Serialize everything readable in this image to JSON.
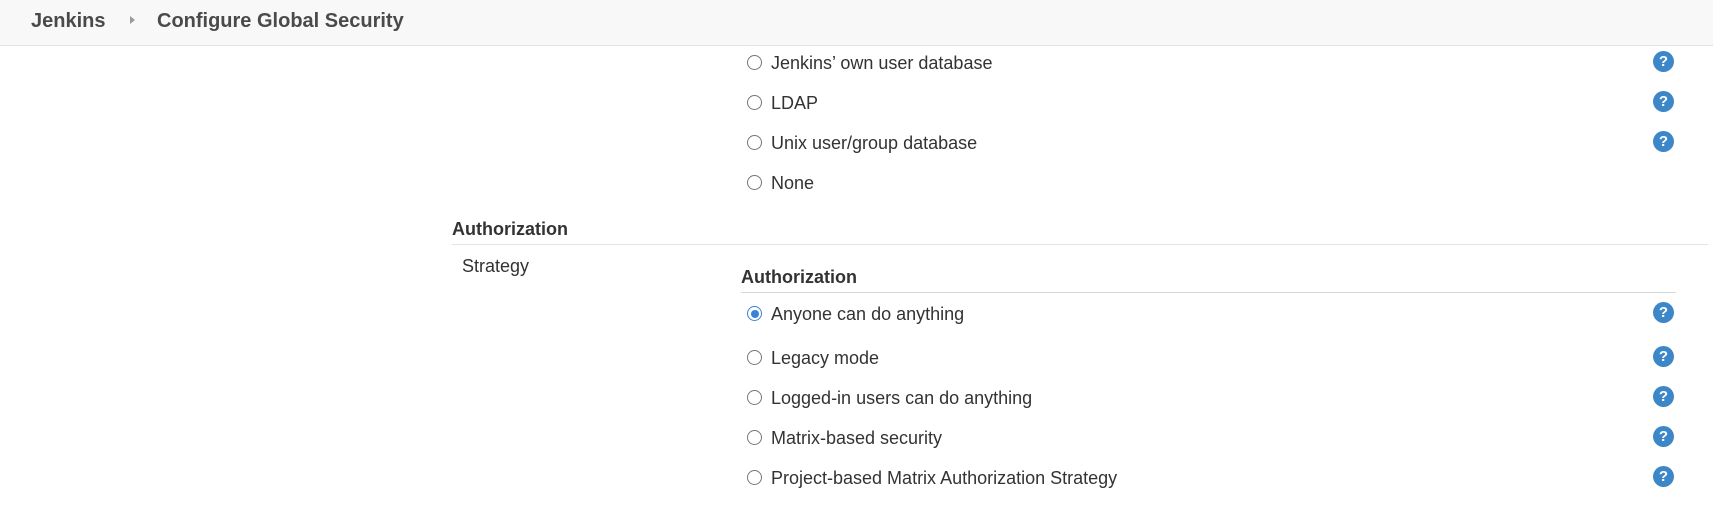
{
  "breadcrumb": {
    "home": "Jenkins",
    "page": "Configure Global Security"
  },
  "security_realm": {
    "options": [
      {
        "label": "Jenkins’ own user database",
        "selected": false,
        "help": true
      },
      {
        "label": "LDAP",
        "selected": false,
        "help": true
      },
      {
        "label": "Unix user/group database",
        "selected": false,
        "help": true
      },
      {
        "label": "None",
        "selected": false,
        "help": false
      }
    ]
  },
  "authorization": {
    "section_title": "Authorization",
    "strategy_label": "Strategy",
    "sub_title": "Authorization",
    "options": [
      {
        "label": "Anyone can do anything",
        "selected": true,
        "help": true
      },
      {
        "label": "Legacy mode",
        "selected": false,
        "help": true
      },
      {
        "label": "Logged-in users can do anything",
        "selected": false,
        "help": true
      },
      {
        "label": "Matrix-based security",
        "selected": false,
        "help": true
      },
      {
        "label": "Project-based Matrix Authorization Strategy",
        "selected": false,
        "help": true
      }
    ]
  },
  "help_icon_text": "?",
  "colors": {
    "help": "#3d87c9",
    "radio_checked": "#3b82d6",
    "topbar": "#f8f8f8"
  }
}
